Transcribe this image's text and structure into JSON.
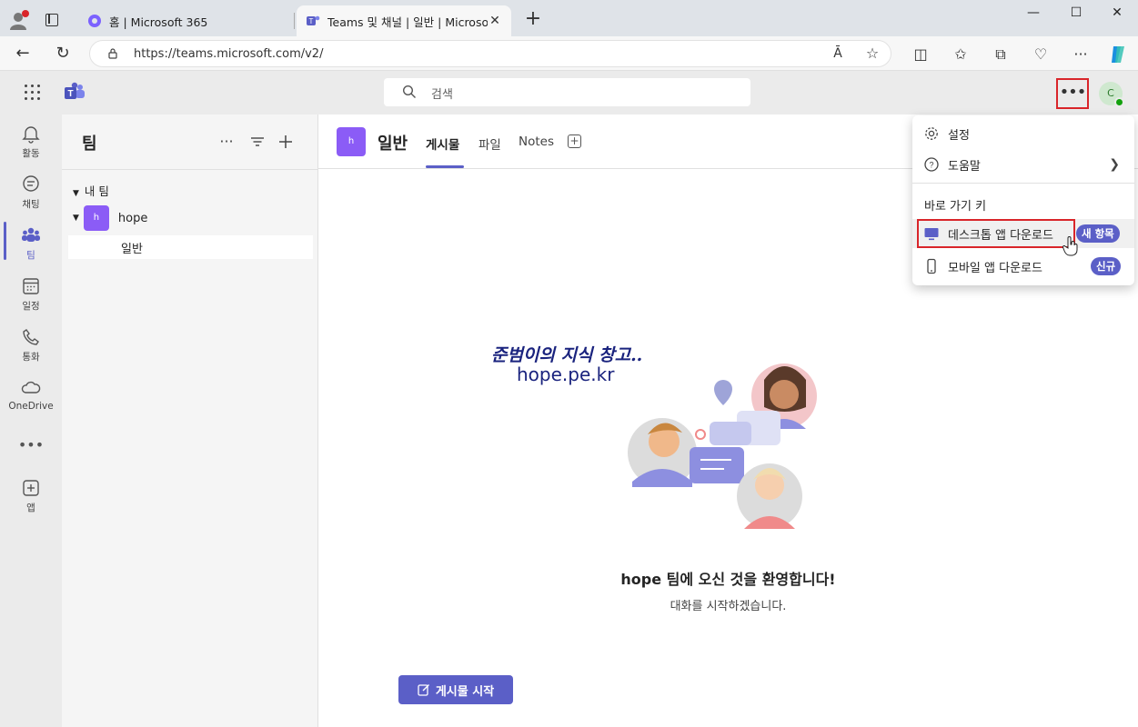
{
  "browser": {
    "tabs": [
      {
        "title": "홈 | Microsoft 365"
      },
      {
        "title": "Teams 및 채널 | 일반 | Microsoft"
      }
    ],
    "url": "https://teams.microsoft.com/v2/",
    "reader_label": "Ā"
  },
  "teams_header": {
    "search_placeholder": "검색",
    "more_label": "•••",
    "avatar_initial": "C"
  },
  "rail": {
    "items": [
      {
        "label": "활동"
      },
      {
        "label": "채팅"
      },
      {
        "label": "팀"
      },
      {
        "label": "일정"
      },
      {
        "label": "통화"
      },
      {
        "label": "OneDrive"
      },
      {
        "label": "•••"
      },
      {
        "label": "앱"
      }
    ]
  },
  "team_list": {
    "title": "팀",
    "more_label": "···",
    "section": "내 팀",
    "team_name": "hope",
    "team_initial": "h",
    "channel": "일반"
  },
  "channel": {
    "initial": "h",
    "name": "일반",
    "tabs": [
      {
        "label": "게시물"
      },
      {
        "label": "파일"
      },
      {
        "label": "Notes"
      }
    ],
    "watermark_line1": "준범이의 지식 창고..",
    "watermark_line2": "hope.pe.kr",
    "welcome": "hope 팀에 오신 것을 환영합니다!",
    "subtitle": "대화를 시작하겠습니다.",
    "start_button": "게시물 시작"
  },
  "menu": {
    "items": [
      {
        "label": "설정"
      },
      {
        "label": "도움말"
      },
      {
        "label": "바로 가기 키"
      },
      {
        "label": "데스크톱 앱 다운로드",
        "badge": "새 항목"
      },
      {
        "label": "모바일 앱 다운로드",
        "badge": "신규"
      }
    ]
  },
  "colors": {
    "accent": "#5b5fc7",
    "team_tile": "#8b5cf6",
    "highlight_box": "#d9252a",
    "status_online": "#13a10e"
  }
}
